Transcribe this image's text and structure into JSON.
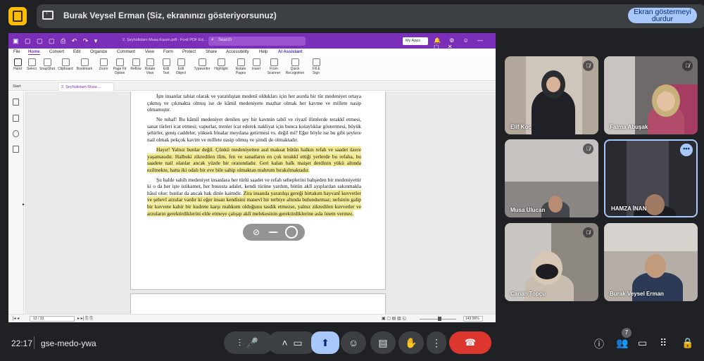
{
  "banner": {
    "title": "Burak Veysel Erman (Siz, ekranınızı gösteriyorsunuz)",
    "stop_line1": "Ekran göstermeyi",
    "stop_line2": "durdur"
  },
  "pdf": {
    "doc_name": "2. Şeyhülislam Musa Kazım.pdf - Foxit PDF Ed...",
    "search_placeholder": "Search",
    "myapps": "My Apps",
    "menu": [
      "File",
      "Home",
      "Convert",
      "Edit",
      "Organize",
      "Comment",
      "View",
      "Form",
      "Protect",
      "Share",
      "Accessibility",
      "Help",
      "AI Assistant"
    ],
    "tools": [
      {
        "l1": "Hand",
        "l2": ""
      },
      {
        "l1": "Select",
        "l2": ""
      },
      {
        "l1": "SnapShot",
        "l2": ""
      },
      {
        "l1": "Clipboard",
        "l2": ""
      },
      {
        "l1": "Bookmark",
        "l2": ""
      },
      {
        "l1": "Zoom",
        "l2": ""
      },
      {
        "l1": "Page Fit",
        "l2": "Option"
      },
      {
        "l1": "Reflow",
        "l2": ""
      },
      {
        "l1": "Rotate",
        "l2": "View"
      },
      {
        "l1": "Edit",
        "l2": "Text"
      },
      {
        "l1": "Edit",
        "l2": "Object"
      },
      {
        "l1": "Typewriter",
        "l2": ""
      },
      {
        "l1": "Highlight",
        "l2": ""
      },
      {
        "l1": "Rotate",
        "l2": "Pages"
      },
      {
        "l1": "Insert",
        "l2": ""
      },
      {
        "l1": "From",
        "l2": "Scanner"
      },
      {
        "l1": "Quick",
        "l2": "Recognition"
      },
      {
        "l1": "Fill &",
        "l2": "Sign"
      }
    ],
    "tabs": [
      "Start",
      "2. Şeyhülislam Musa ..."
    ],
    "page_indicator": "13 / 33",
    "zoom_value": "143.96%",
    "paragraphs": [
      "İşte insanlar tabiat olarak ve yaratılıştan medenî oldukları için her asırda bir tür medeniyet ortaya çıkmış ve çıkmakta olmuş ise de kâmil medeniyete mazhar olmak her kavme ve millete nasip olmamıştır.",
      "Ne tuhaf! Bu kâmil medeniyet denilen şey bir kavmin tabiî ve riyazî ilimlerde terakkî etmesi, sanat türleri icat etmesi; vapurlar, trenler icat ederek nakliyat için bunca kolaylıklar göstermesi, büyük şehirler, geniş caddeler, yüksek binalar meydana getirmesi vs. değil mi? Eğer böyle ise bu gibi şeylere nail olmak pekçok kavim ve millete nasip olmuş ve şimdi de olmaktadır.",
      "Hayır! Yalnız bunlar değil. Çünkü medeniyetten asıl maksat bütün halkın refah ve saadet üzere yaşamasıdır. Halbuki zikredilen ilim, fen ve sanatların en çok terakkî ettiği yerlerde bu refaha, bu saadete nail olanlar ancak yüzde bir oranındadır. Geri kalan halk maişet derdinin yükü altında ezilmekte, hatta iki odalı bir eve bile sahip olmaktan mahrum bırakılmaktadır.",
      "Şu halde sahih medeniyet insanlara her türlü saadet ve refah sebeplerini bahşeden bir medeniyettir ki o da her işte istikamet, her hususta adalet, kendi türüne yardım, bütün aklî ayıplardan sakınmakla hâsıl olur; bunlar da ancak hak dinle kaimdir.",
      "Zira insanda yaratılışı gereği birtakım hayvanî kuvvetler ve şehevî arzular vardır ki eğer insan kendisini manevî bir terbiye altında bulundurmaz; nefsinin galip bir kuvvete kahir bir kudrete karşı mahkum olduğunu tasdik etmezse, yalnız zikredilen kuvvetler ve arzuların gerektirdiklerini elde etmeye çalışıp aklî melekesinin gerektirdiklerine asla önem vermez."
    ]
  },
  "participants": [
    {
      "name": "Elif Koç",
      "muted": true
    },
    {
      "name": "Fatma Abuşak",
      "muted": true
    },
    {
      "name": "Musa Ulucan",
      "muted": true
    },
    {
      "name": "HAMZA İNAN",
      "muted": false
    },
    {
      "name": "Canan Topçu",
      "muted": true
    },
    {
      "name": "Burak Veysel Erman",
      "muted": false
    }
  ],
  "bottom": {
    "time": "22:17",
    "meeting_code": "gse-medo-ywa",
    "participant_count": "7"
  }
}
